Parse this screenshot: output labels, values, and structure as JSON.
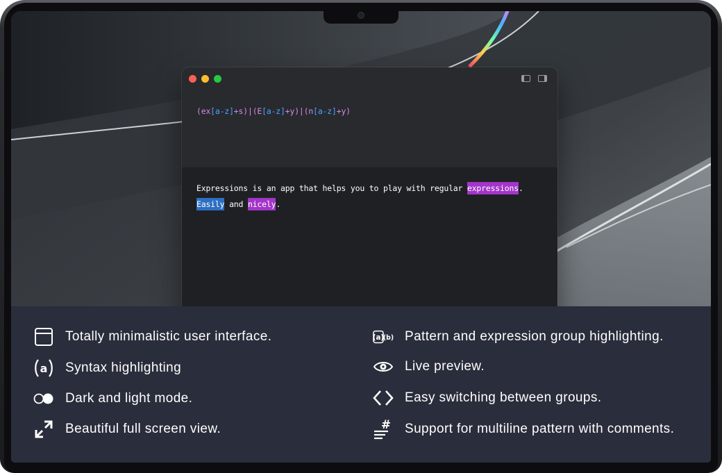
{
  "editor": {
    "pattern": [
      {
        "t": "(ex",
        "c": "grp"
      },
      {
        "t": "[a-z]",
        "c": "cls"
      },
      {
        "t": "+s)|(E",
        "c": "grp"
      },
      {
        "t": "[a-z]",
        "c": "cls"
      },
      {
        "t": "+y)|(n",
        "c": "grp"
      },
      {
        "t": "[a-z]",
        "c": "cls"
      },
      {
        "t": "+y)",
        "c": "grp"
      }
    ],
    "test_line1_prefix": "Expressions is an app that helps you to play with regular ",
    "test_line1_match": "expressions",
    "test_line1_suffix": ".",
    "test_line2_match1": "Easily",
    "test_line2_mid": " and ",
    "test_line2_match2": "nicely",
    "test_line2_suffix": "."
  },
  "features": {
    "left": [
      {
        "icon": "window-icon",
        "label": "Totally minimalistic user interface."
      },
      {
        "icon": "at-syntax-icon",
        "label": "Syntax highlighting"
      },
      {
        "icon": "toggle-icon",
        "label": "Dark and light mode."
      },
      {
        "icon": "expand-arrows-icon",
        "label": "Beautiful full screen view."
      }
    ],
    "right": [
      {
        "icon": "group-highlight-icon",
        "label": "Pattern and expression group highlighting."
      },
      {
        "icon": "eye-icon",
        "label": "Live preview."
      },
      {
        "icon": "code-brackets-icon",
        "label": "Easy switching between groups."
      },
      {
        "icon": "multiline-hash-icon",
        "label": "Support for multiline pattern with comments."
      }
    ]
  },
  "colors": {
    "group_purple": "#d58ae6",
    "class_blue": "#4aa3ff",
    "highlight_purple": "#a335c9",
    "highlight_blue": "#2c6fc2",
    "panel_bg": "#2a2d3b"
  }
}
